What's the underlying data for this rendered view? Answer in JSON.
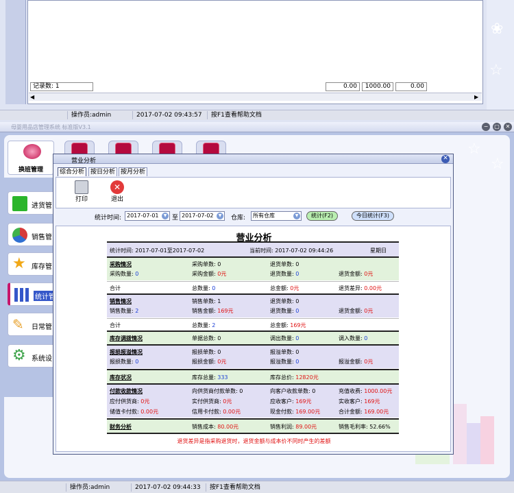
{
  "bg_window": {
    "record_count": "记录数: 1",
    "sum1": "0.00",
    "sum2": "1000.00",
    "sum3": "0.00",
    "status": {
      "operator": "操作员:admin",
      "time": "2017-07-02 09:43:57",
      "help": "按F1查看帮助文档"
    }
  },
  "main_window": {
    "title": "母婴用品店管理系统 标准版V3.1",
    "window_buttons": [
      "−",
      "▢",
      "✕"
    ],
    "huanban_label": "换班管理",
    "nav_items": [
      {
        "label": "进货管",
        "icon": "plus-icon",
        "color": "#2bb52b"
      },
      {
        "label": "销售管",
        "icon": "pie-icon",
        "color": "#d63a3a"
      },
      {
        "label": "库存管",
        "icon": "star-icon",
        "color": "#f1a817"
      },
      {
        "label": "统计管",
        "icon": "bars-icon",
        "color": "#3557c9"
      },
      {
        "label": "日常管",
        "icon": "tools-icon",
        "color": "#e7a02a"
      },
      {
        "label": "系统设",
        "icon": "gear-icon",
        "color": "#3ea34a"
      }
    ],
    "status": {
      "operator": "操作员:admin",
      "time": "2017-07-02 09:44:33",
      "help": "按F1查看帮助文档"
    }
  },
  "dialog": {
    "title": "营业分析",
    "close": "✕",
    "tabs": [
      "综合分析",
      "按日分析",
      "按月分析"
    ],
    "toolbar": {
      "print": "打印",
      "exit": "退出"
    },
    "filter": {
      "label_time": "统计时间:",
      "date_from": "2017-07-01",
      "to": "至",
      "date_to": "2017-07-02",
      "label_store": "仓库:",
      "store": "所有仓库",
      "btn_stat": "统计(F2)",
      "btn_today": "今日统计(F3)"
    },
    "report": {
      "title": "营业分析",
      "header": {
        "period": "统计时间: 2017-07-01至2017-07-02",
        "now": "当前时间: 2017-07-02 09:44:26",
        "weekday": "星期日"
      },
      "purchase": {
        "section": "采购情况",
        "order_count": "采购单数: 0",
        "return_count": "退货单数: 0",
        "qty_label": "采购数量: ",
        "qty": "0",
        "amount_label": "采购金额: ",
        "amount": "0元",
        "ret_qty_label": "退货数量: ",
        "ret_qty": "0",
        "ret_amount_label": "退货金额: ",
        "ret_amount": "0元",
        "total": "合计",
        "tot_qty_label": "总数量: ",
        "tot_qty": "0",
        "tot_amt_label": "总金额: ",
        "tot_amt": "0元",
        "diff_label": "退货差异: ",
        "diff": "0.00元"
      },
      "sales": {
        "section": "销售情况",
        "order_count": "销售单数: 1",
        "return_count": "退货单数: 0",
        "qty_label": "销售数量: ",
        "qty": "2",
        "amount_label": "销售金额: ",
        "amount": "169元",
        "ret_qty_label": "退货数量: ",
        "ret_qty": "0",
        "ret_amount_label": "退货金额: ",
        "ret_amount": "0元",
        "total": "合计",
        "tot_qty_label": "总数量: ",
        "tot_qty": "2",
        "tot_amt_label": "总金额: ",
        "tot_amt": "169元"
      },
      "transfer": {
        "section": "库存调拨情况",
        "count": "单据总数: 0",
        "out_label": "调出数量: ",
        "out": "0",
        "in_label": "调入数量: ",
        "in": "0"
      },
      "loss": {
        "section": "报损报溢情况",
        "loss_count": "报损单数: 0",
        "gain_count": "报溢单数: 0",
        "loss_qty_label": "报损数量: ",
        "loss_qty": "0",
        "loss_amt_label": "报损金额: ",
        "loss_amt": "0元",
        "gain_qty_label": "报溢数量: ",
        "gain_qty": "0",
        "gain_amt_label": "报溢金额: ",
        "gain_amt": "0元"
      },
      "stock": {
        "section": "库存状况",
        "total_label": "库存总量: ",
        "total": "333",
        "value_label": "库存总价: ",
        "value": "12820元"
      },
      "payment": {
        "section": "付款收款情况",
        "sup_pay_count": "向供货商付款单数: 0",
        "cust_recv_count": "向客户收款单数: 0",
        "recharge_label": "充值收费: ",
        "recharge": "1000.00元",
        "payable_label": "应付供货商: ",
        "payable": "0元",
        "paid_label": "实付供货商: ",
        "paid": "0元",
        "receivable_label": "应收客户: ",
        "receivable": "169元",
        "received_label": "实收客户: ",
        "received": "169元",
        "card_label": "储值卡付款: ",
        "card": "0.00元",
        "credit_label": "信用卡付款: ",
        "credit": "0.00元",
        "cash_label": "现金付款: ",
        "cash": "169.00元",
        "sum_label": "合计金额: ",
        "sum": "169.00元"
      },
      "finance": {
        "section": "财务分析",
        "cost_label": "销售成本: ",
        "cost": "80.00元",
        "profit_label": "销售利润: ",
        "profit": "89.00元",
        "margin": "销售毛利率: 52.66%"
      },
      "note": "退货差异是指采购退货时，退货金额与成本价不同时产生的差额"
    }
  }
}
